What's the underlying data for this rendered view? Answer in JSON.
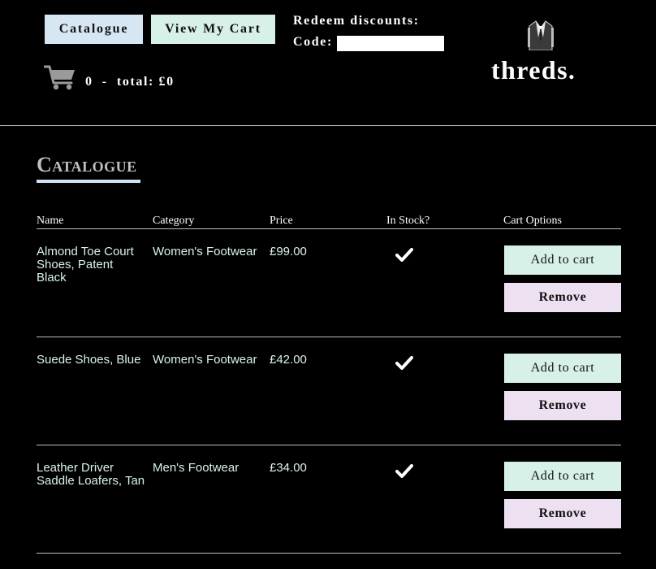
{
  "header": {
    "catalogue_button": "Catalogue",
    "cart_button": "View My Cart",
    "discount_label": "Redeem discounts:",
    "code_label": "Code:",
    "code_value": "",
    "cart_summary": "0  -  total: £0",
    "logo_text": "threds."
  },
  "catalogue": {
    "title": "Catalogue",
    "columns": {
      "name": "Name",
      "category": "Category",
      "price": "Price",
      "in_stock": "In Stock?",
      "cart_options": "Cart Options"
    },
    "products": [
      {
        "name": "Almond Toe Court Shoes, Patent Black",
        "category": "Women's Footwear",
        "price": "£99.00",
        "in_stock": true,
        "add_label": "Add to cart",
        "remove_label": "Remove"
      },
      {
        "name": "Suede Shoes, Blue",
        "category": "Women's Footwear",
        "price": "£42.00",
        "in_stock": true,
        "add_label": "Add to cart",
        "remove_label": "Remove"
      },
      {
        "name": "Leather Driver Saddle Loafers, Tan",
        "category": "Men's Footwear",
        "price": "£34.00",
        "in_stock": true,
        "add_label": "Add to cart",
        "remove_label": "Remove"
      }
    ]
  },
  "icons": {
    "cart": "shopping-cart-icon",
    "logo": "suit-icon",
    "stock": "checkmark-icon"
  },
  "colors": {
    "background": "#000000",
    "catalogue_button": "#d7e6f3",
    "add_button": "#d7f1e8",
    "remove_button": "#ede1f1",
    "text_cells": "#d9f3ee"
  }
}
